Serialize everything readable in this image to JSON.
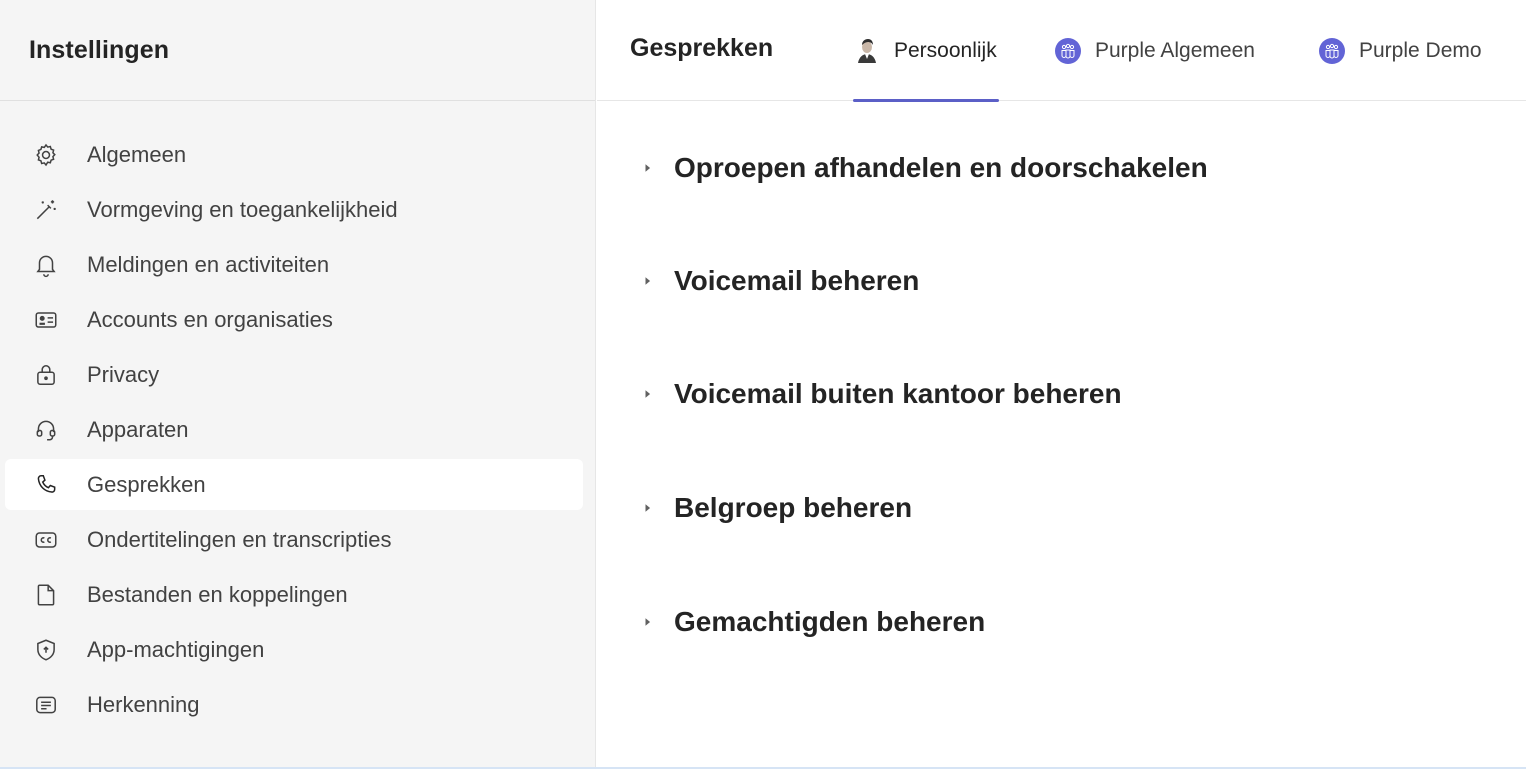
{
  "sidebar": {
    "title": "Instellingen",
    "items": [
      {
        "label": "Algemeen",
        "icon": "gear-icon"
      },
      {
        "label": "Vormgeving en toegankelijkheid",
        "icon": "magic-wand-icon"
      },
      {
        "label": "Meldingen en activiteiten",
        "icon": "bell-icon"
      },
      {
        "label": "Accounts en organisaties",
        "icon": "contact-card-icon"
      },
      {
        "label": "Privacy",
        "icon": "lock-icon"
      },
      {
        "label": "Apparaten",
        "icon": "headset-icon"
      },
      {
        "label": "Gesprekken",
        "icon": "phone-icon",
        "active": true
      },
      {
        "label": "Ondertitelingen en transcripties",
        "icon": "closed-caption-icon"
      },
      {
        "label": "Bestanden en koppelingen",
        "icon": "document-icon"
      },
      {
        "label": "App-machtigingen",
        "icon": "shield-icon"
      },
      {
        "label": "Herkenning",
        "icon": "text-box-icon"
      }
    ]
  },
  "header": {
    "title": "Gesprekken",
    "tabs": [
      {
        "label": "Persoonlijk",
        "icon": "person-avatar-icon",
        "active": true
      },
      {
        "label": "Purple Algemeen",
        "icon": "team-icon"
      },
      {
        "label": "Purple Demo",
        "icon": "team-icon"
      }
    ]
  },
  "sections": [
    {
      "title": "Oproepen afhandelen en doorschakelen"
    },
    {
      "title": "Voicemail beheren"
    },
    {
      "title": "Voicemail buiten kantoor beheren"
    },
    {
      "title": "Belgroep beheren"
    },
    {
      "title": "Gemachtigden beheren"
    }
  ],
  "colors": {
    "accent": "#5b5fc7",
    "sidebar_bg": "#f5f5f5",
    "team_icon_bg": "#6264d6"
  }
}
